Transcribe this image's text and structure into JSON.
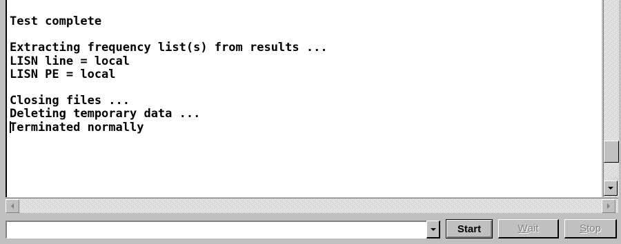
{
  "console": {
    "lines": [
      "Test complete",
      "",
      "Extracting frequency list(s) from results ...",
      "LISN line = local",
      "LISN PE = local",
      "",
      "Closing files ...",
      "Deleting temporary data ...",
      "Terminated normally"
    ]
  },
  "command": {
    "value": "",
    "placeholder": ""
  },
  "buttons": {
    "start": "Start",
    "wait_mnemonic": "W",
    "wait_rest": "ait",
    "stop_mnemonic": "S",
    "stop_rest": "top"
  },
  "icons": {
    "dropdown": "chevron-down-icon",
    "scroll_left": "arrow-left-icon",
    "scroll_right": "arrow-right-icon",
    "scroll_down": "arrow-down-icon"
  }
}
